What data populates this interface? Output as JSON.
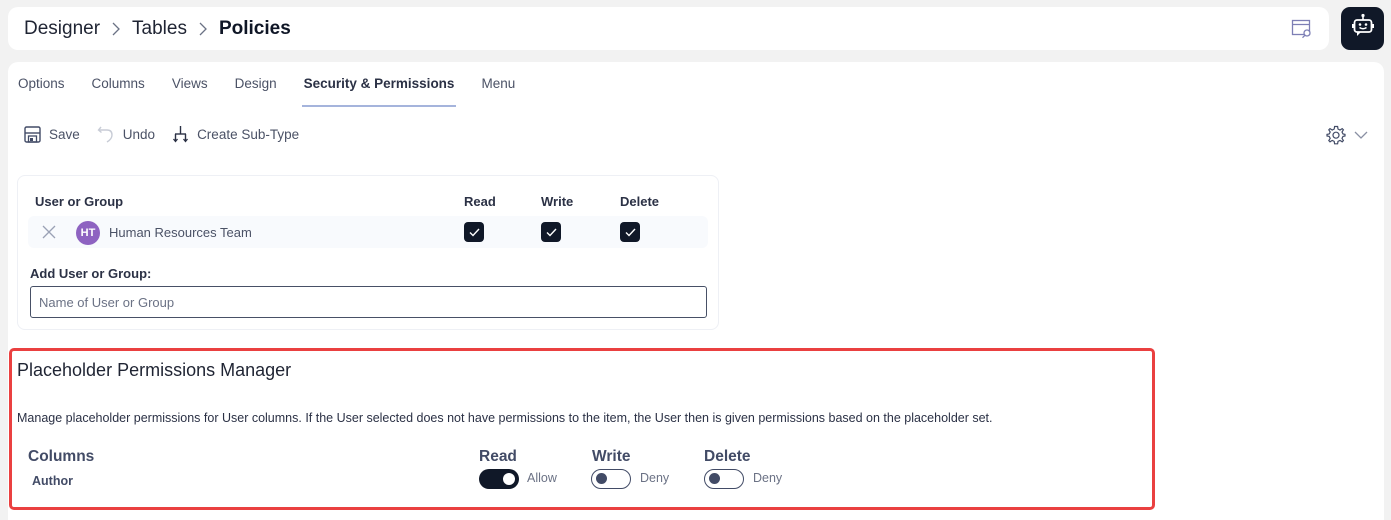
{
  "breadcrumb": {
    "items": [
      "Designer",
      "Tables",
      "Policies"
    ]
  },
  "header": {
    "view_icon": "window-search-icon",
    "assistant_icon": "robot-chat-icon"
  },
  "tabs": [
    {
      "label": "Options",
      "active": false
    },
    {
      "label": "Columns",
      "active": false
    },
    {
      "label": "Views",
      "active": false
    },
    {
      "label": "Design",
      "active": false
    },
    {
      "label": "Security & Permissions",
      "active": true
    },
    {
      "label": "Menu",
      "active": false
    }
  ],
  "toolbar": {
    "save_label": "Save",
    "undo_label": "Undo",
    "create_subtype_label": "Create Sub-Type"
  },
  "permissions": {
    "headers": {
      "user": "User or Group",
      "read": "Read",
      "write": "Write",
      "delete": "Delete"
    },
    "rows": [
      {
        "initials": "HT",
        "name": "Human Resources Team",
        "read": true,
        "write": true,
        "delete": true,
        "avatar_color": "#8e63c1"
      }
    ],
    "add_label": "Add User or Group:",
    "add_placeholder": "Name of User or Group"
  },
  "placeholder_manager": {
    "title": "Placeholder Permissions Manager",
    "description": "Manage placeholder permissions for User columns. If the User selected does not have permissions to the item, the User then is given permissions based on the placeholder set.",
    "headers": {
      "columns": "Columns",
      "read": "Read",
      "write": "Write",
      "delete": "Delete"
    },
    "rows": [
      {
        "column": "Author",
        "read": {
          "on": true,
          "label": "Allow"
        },
        "write": {
          "on": false,
          "label": "Deny"
        },
        "delete": {
          "on": false,
          "label": "Deny"
        }
      }
    ]
  },
  "colors": {
    "primary_dark": "#101828",
    "highlight_border": "#ea4040",
    "tab_underline": "#a5b4dc",
    "avatar": "#8e63c1"
  }
}
